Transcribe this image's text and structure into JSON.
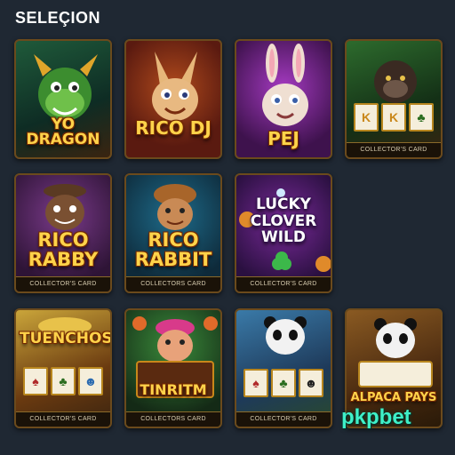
{
  "header": {
    "title": "SELEÇION"
  },
  "cards": [
    {
      "title": "YO DRAGON",
      "footer": "",
      "icon": "dragon-icon"
    },
    {
      "title": "RICO DJ",
      "footer": "",
      "icon": "rabbit-dj-icon"
    },
    {
      "title": "PEJ",
      "footer": "",
      "icon": "bunny-icon"
    },
    {
      "title": "",
      "footer": "COLLECTOR'S CARD",
      "reels": [
        "K",
        "K",
        "♣"
      ],
      "icon": "gorilla-icon"
    },
    {
      "title": "RICO RABBY",
      "footer": "COLLECTOR'S CARD",
      "icon": "monkey-icon"
    },
    {
      "title": "RICO RABBIT",
      "footer": "COLLECTORS CARD",
      "icon": "explorer-icon"
    },
    {
      "title": "LUCKY CLOVER WILD",
      "footer": "COLLECTOR'S CARD",
      "icon": "clover-icon"
    },
    {
      "title": "TUENCHOS",
      "footer": "COLLECTOR'S CARD",
      "reels": [
        "♠",
        "♣",
        "☻"
      ],
      "icon": "frog-icon"
    },
    {
      "title": "TINRITM",
      "footer": "COLLECTORS CARD",
      "icon": "clown-icon"
    },
    {
      "title": "",
      "footer": "COLLECTOR'S CARD",
      "reels": [
        "♠",
        "♣",
        "☻"
      ],
      "icon": "panda-icon"
    },
    {
      "title": "ALPACA PAYS",
      "footer": "",
      "icon": "panda-icon"
    }
  ],
  "brand": {
    "text": "pkpbet"
  }
}
